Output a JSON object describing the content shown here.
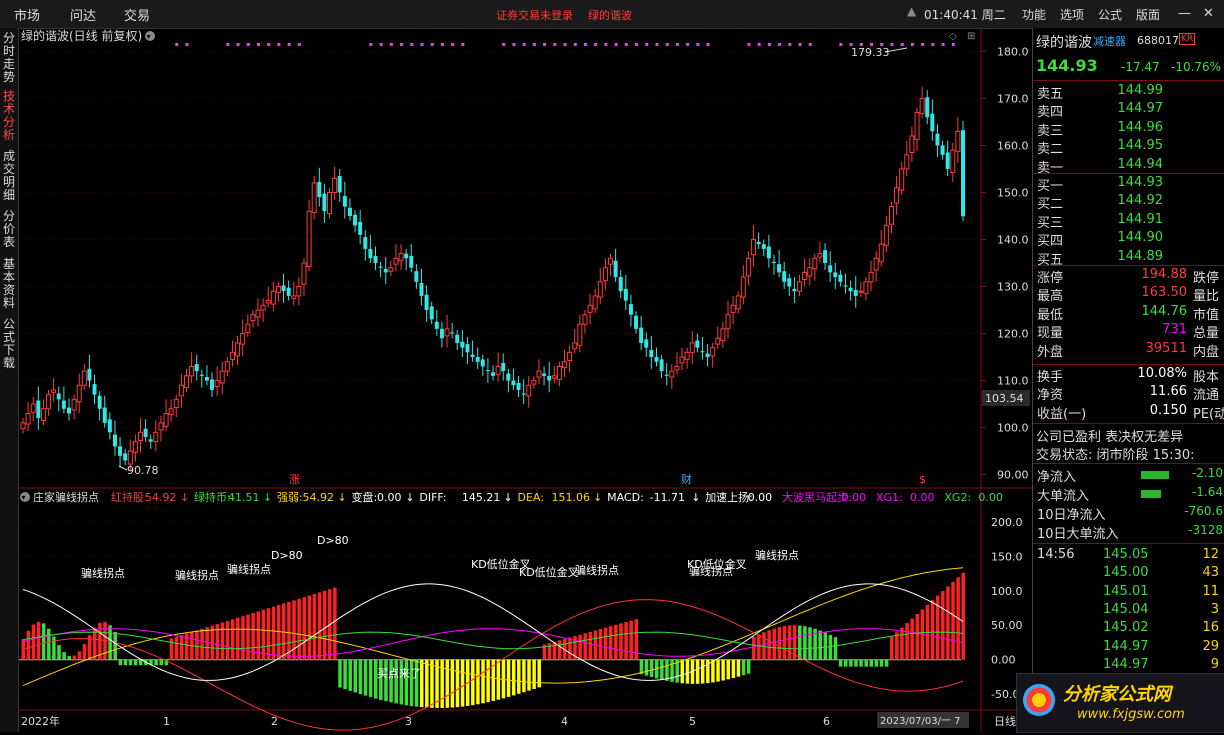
{
  "topbar": {
    "menus": [
      "市场",
      "问达",
      "交易"
    ],
    "notice_login": "证券交易未登录",
    "notice_stock": "绿的谐波",
    "clock": "01:40:41 周二",
    "right_menus": [
      "功能",
      "选项",
      "公式",
      "版面"
    ]
  },
  "leftnav": [
    "分时走势",
    "技术分析",
    "成交明细",
    "分价表",
    "基本资料",
    "公式下载"
  ],
  "main_chart": {
    "title": "绿的谐波(日线 前复权)",
    "high_label": "179.33",
    "low_label": "90.78",
    "y_ticks": [
      "180.0",
      "170.0",
      "160.0",
      "150.0",
      "140.0",
      "130.0",
      "120.0",
      "110.0",
      "100.0",
      "90.00"
    ],
    "cursor_price": "103.54",
    "marker_zhang": "涨",
    "marker_cai": "财",
    "marker_s": "$"
  },
  "indicator": {
    "name": "庄家骗线拐点",
    "items": [
      {
        "label": "红持股:",
        "value": "54.92",
        "color": "#ff3b3b"
      },
      {
        "label": "绿持币:",
        "value": "41.51",
        "color": "#3ddc3d"
      },
      {
        "label": "强弱:",
        "value": "54.92",
        "color": "#ffd400"
      },
      {
        "label": "变盘:",
        "value": "0.00",
        "color": "#ffffff"
      },
      {
        "label": "DIFF:",
        "value": "145.21",
        "color": "#ffffff"
      },
      {
        "label": "DEA:",
        "value": "151.06",
        "color": "#ffd400"
      },
      {
        "label": "MACD:",
        "value": "-11.71",
        "color": "#ffffff"
      },
      {
        "label": "加速上扬:",
        "value": "0.00",
        "color": "#ffffff"
      },
      {
        "label": "大波黑马起步:",
        "value": "0.00",
        "color": "#ff00ff"
      },
      {
        "label": "XG1:",
        "value": "0.00",
        "color": "#ff00ff"
      },
      {
        "label": "XG2:",
        "value": "0.00",
        "color": "#3ddc3d"
      }
    ],
    "y_ticks": [
      "200.0",
      "150.0",
      "100.0",
      "50.00",
      "0.00",
      "-50.00"
    ],
    "annotations": {
      "pianxian": "骗线拐点",
      "d80": "D>80",
      "kd": "KD低位金叉",
      "maidian": "买点来了"
    }
  },
  "x_axis": {
    "labels": [
      "2022年",
      "1",
      "2",
      "3",
      "4",
      "5",
      "6"
    ],
    "date": "2023/07/03/一 7",
    "tab": "日线"
  },
  "quote": {
    "name": "绿的谐波",
    "badge": "减速器",
    "code": "688017",
    "kr": "KR",
    "price": "144.93",
    "change": "-17.47",
    "pct": "-10.76%",
    "asks": [
      {
        "label": "卖五",
        "price": "144.99"
      },
      {
        "label": "卖四",
        "price": "144.97"
      },
      {
        "label": "卖三",
        "price": "144.96"
      },
      {
        "label": "卖二",
        "price": "144.95"
      },
      {
        "label": "卖一",
        "price": "144.94"
      }
    ],
    "bids": [
      {
        "label": "买一",
        "price": "144.93"
      },
      {
        "label": "买二",
        "price": "144.92"
      },
      {
        "label": "买三",
        "price": "144.91"
      },
      {
        "label": "买四",
        "price": "144.90"
      },
      {
        "label": "买五",
        "price": "144.89"
      }
    ],
    "stats": [
      {
        "label": "涨停",
        "value": "194.88",
        "label2": "跌停",
        "color": "#ff3b3b"
      },
      {
        "label": "最高",
        "value": "163.50",
        "label2": "量比",
        "color": "#ff3b3b"
      },
      {
        "label": "最低",
        "value": "144.76",
        "label2": "市值",
        "color": "#3ddc3d"
      },
      {
        "label": "现量",
        "value": "731",
        "label2": "总量",
        "color": "#ff00ff"
      },
      {
        "label": "外盘",
        "value": "39511",
        "label2": "内盘",
        "color": "#ff3b3b"
      }
    ],
    "stats2": [
      {
        "label": "换手",
        "value": "10.08%",
        "label2": "股本"
      },
      {
        "label": "净资",
        "value": "11.66",
        "label2": "流通"
      },
      {
        "label": "收益(一)",
        "value": "0.150",
        "label2": "PE(动)"
      }
    ],
    "company": "公司已盈利 表决权无差异",
    "status": "交易状态: 闭市阶段 15:30:",
    "flows": [
      {
        "label": "净流入",
        "value": "-2.10"
      },
      {
        "label": "大单流入",
        "value": "-1.64"
      },
      {
        "label": "10日净流入",
        "value": "-760.6"
      },
      {
        "label": "10日大单流入",
        "value": "-3128"
      }
    ],
    "ticks": [
      {
        "time": "14:56",
        "price": "145.05",
        "vol": "12",
        "color": "#3ddc3d"
      },
      {
        "time": "",
        "price": "145.00",
        "vol": "43",
        "color": "#3ddc3d"
      },
      {
        "time": "",
        "price": "145.01",
        "vol": "11",
        "color": "#3ddc3d"
      },
      {
        "time": "",
        "price": "145.04",
        "vol": "3",
        "color": "#3ddc3d"
      },
      {
        "time": "",
        "price": "145.02",
        "vol": "16",
        "color": "#3ddc3d"
      },
      {
        "time": "",
        "price": "144.97",
        "vol": "29",
        "color": "#3ddc3d"
      },
      {
        "time": "",
        "price": "144.97",
        "vol": "9",
        "color": "#3ddc3d"
      }
    ]
  },
  "logo": {
    "cn": "分析家公式网",
    "url": "www.fxjgsw.com"
  },
  "colors": {
    "up": "#ff3b3b",
    "down": "#33e6e6",
    "bg": "#000000",
    "grid": "#3a0000"
  },
  "chart_data": [
    {
      "type": "candlestick",
      "title": "绿的谐波(日线 前复权)",
      "ylim": [
        88,
        182
      ],
      "y_ticks": [
        90,
        100,
        110,
        120,
        130,
        140,
        150,
        160,
        170,
        180
      ],
      "x_labels": [
        "2022年",
        "1",
        "2",
        "3",
        "4",
        "5",
        "6"
      ],
      "highest": 179.33,
      "lowest": 90.78,
      "last_close": 144.93,
      "closes": [
        101,
        103,
        105,
        102,
        104,
        107,
        108,
        106,
        104,
        103,
        106,
        109,
        112,
        110,
        107,
        104,
        101,
        99,
        96,
        94,
        93,
        95,
        97,
        99,
        98,
        97,
        99,
        101,
        103,
        104,
        106,
        109,
        111,
        113,
        112,
        111,
        110,
        108,
        110,
        112,
        114,
        116,
        118,
        120,
        122,
        124,
        125,
        126,
        127,
        129,
        130,
        129,
        128,
        128,
        130,
        135,
        146,
        152,
        149,
        146,
        150,
        153,
        150,
        147,
        145,
        143,
        141,
        138,
        136,
        135,
        134,
        133,
        134,
        136,
        137,
        136,
        134,
        131,
        128,
        125,
        123,
        121,
        119,
        121,
        120,
        118,
        117,
        116,
        115,
        114,
        113,
        112,
        111,
        113,
        112,
        110,
        109,
        108,
        107,
        109,
        110,
        112,
        111,
        110,
        111,
        113,
        114,
        116,
        118,
        122,
        124,
        126,
        128,
        131,
        134,
        136,
        132,
        129,
        127,
        124,
        121,
        118,
        117,
        115,
        114,
        112,
        111,
        112,
        113,
        115,
        116,
        118,
        117,
        116,
        115,
        117,
        119,
        121,
        124,
        126,
        128,
        132,
        136,
        140,
        139,
        138,
        136,
        135,
        133,
        131,
        130,
        129,
        131,
        133,
        134,
        136,
        137,
        135,
        133,
        132,
        131,
        130,
        129,
        128,
        129,
        131,
        133,
        136,
        139,
        143,
        147,
        151,
        155,
        158,
        162,
        167,
        170,
        166,
        163,
        160,
        158,
        155,
        159,
        163,
        144.93
      ]
    },
    {
      "type": "bar",
      "title": "庄家骗线拐点",
      "ylim": [
        -70,
        220
      ],
      "y_ticks": [
        200,
        150,
        100,
        50,
        0,
        -50
      ]
    }
  ]
}
